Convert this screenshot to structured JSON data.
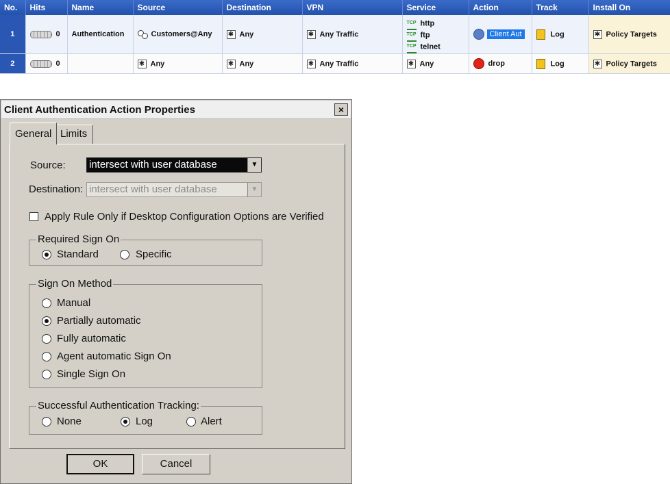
{
  "rule_table": {
    "columns": [
      "No.",
      "Hits",
      "Name",
      "Source",
      "Destination",
      "VPN",
      "Service",
      "Action",
      "Track",
      "Install On"
    ],
    "rows": [
      {
        "no": "1",
        "hits": "0",
        "name": "Authentication",
        "source": "Customers@Any",
        "destination": "Any",
        "vpn": "Any Traffic",
        "services": [
          "http",
          "ftp",
          "telnet"
        ],
        "service_tag": "TCP",
        "action": "Client Aut",
        "track": "Log",
        "install_on": "Policy Targets"
      },
      {
        "no": "2",
        "hits": "0",
        "name": "",
        "source": "Any",
        "destination": "Any",
        "vpn": "Any Traffic",
        "service": "Any",
        "action": "drop",
        "track": "Log",
        "install_on": "Policy Targets"
      }
    ]
  },
  "dialog": {
    "title": "Client Authentication Action Properties",
    "close_glyph": "×",
    "tabs": [
      {
        "label": "General",
        "active": true
      },
      {
        "label": "Limits",
        "active": false
      }
    ],
    "source_label": "Source:",
    "source_value": "intersect with user database",
    "destination_label": "Destination:",
    "destination_value": "intersect with user database",
    "apply_rule_label": "Apply Rule Only if Desktop Configuration Options are Verified",
    "apply_rule_checked": false,
    "required_sign_on": {
      "legend": "Required Sign On",
      "options": [
        "Standard",
        "Specific"
      ],
      "selected": "Standard"
    },
    "sign_on_method": {
      "legend": "Sign On Method",
      "options": [
        "Manual",
        "Partially automatic",
        "Fully automatic",
        "Agent automatic Sign On",
        "Single Sign On"
      ],
      "selected": "Partially automatic"
    },
    "tracking": {
      "legend": "Successful Authentication Tracking:",
      "options": [
        "None",
        "Log",
        "Alert"
      ],
      "selected": "Log"
    },
    "ok_label": "OK",
    "cancel_label": "Cancel"
  },
  "colors": {
    "header_blue": "#2452ad",
    "client_auth_highlight": "#1f78e8",
    "drop_red": "#e2231a",
    "log_yellow": "#f3c21b"
  }
}
